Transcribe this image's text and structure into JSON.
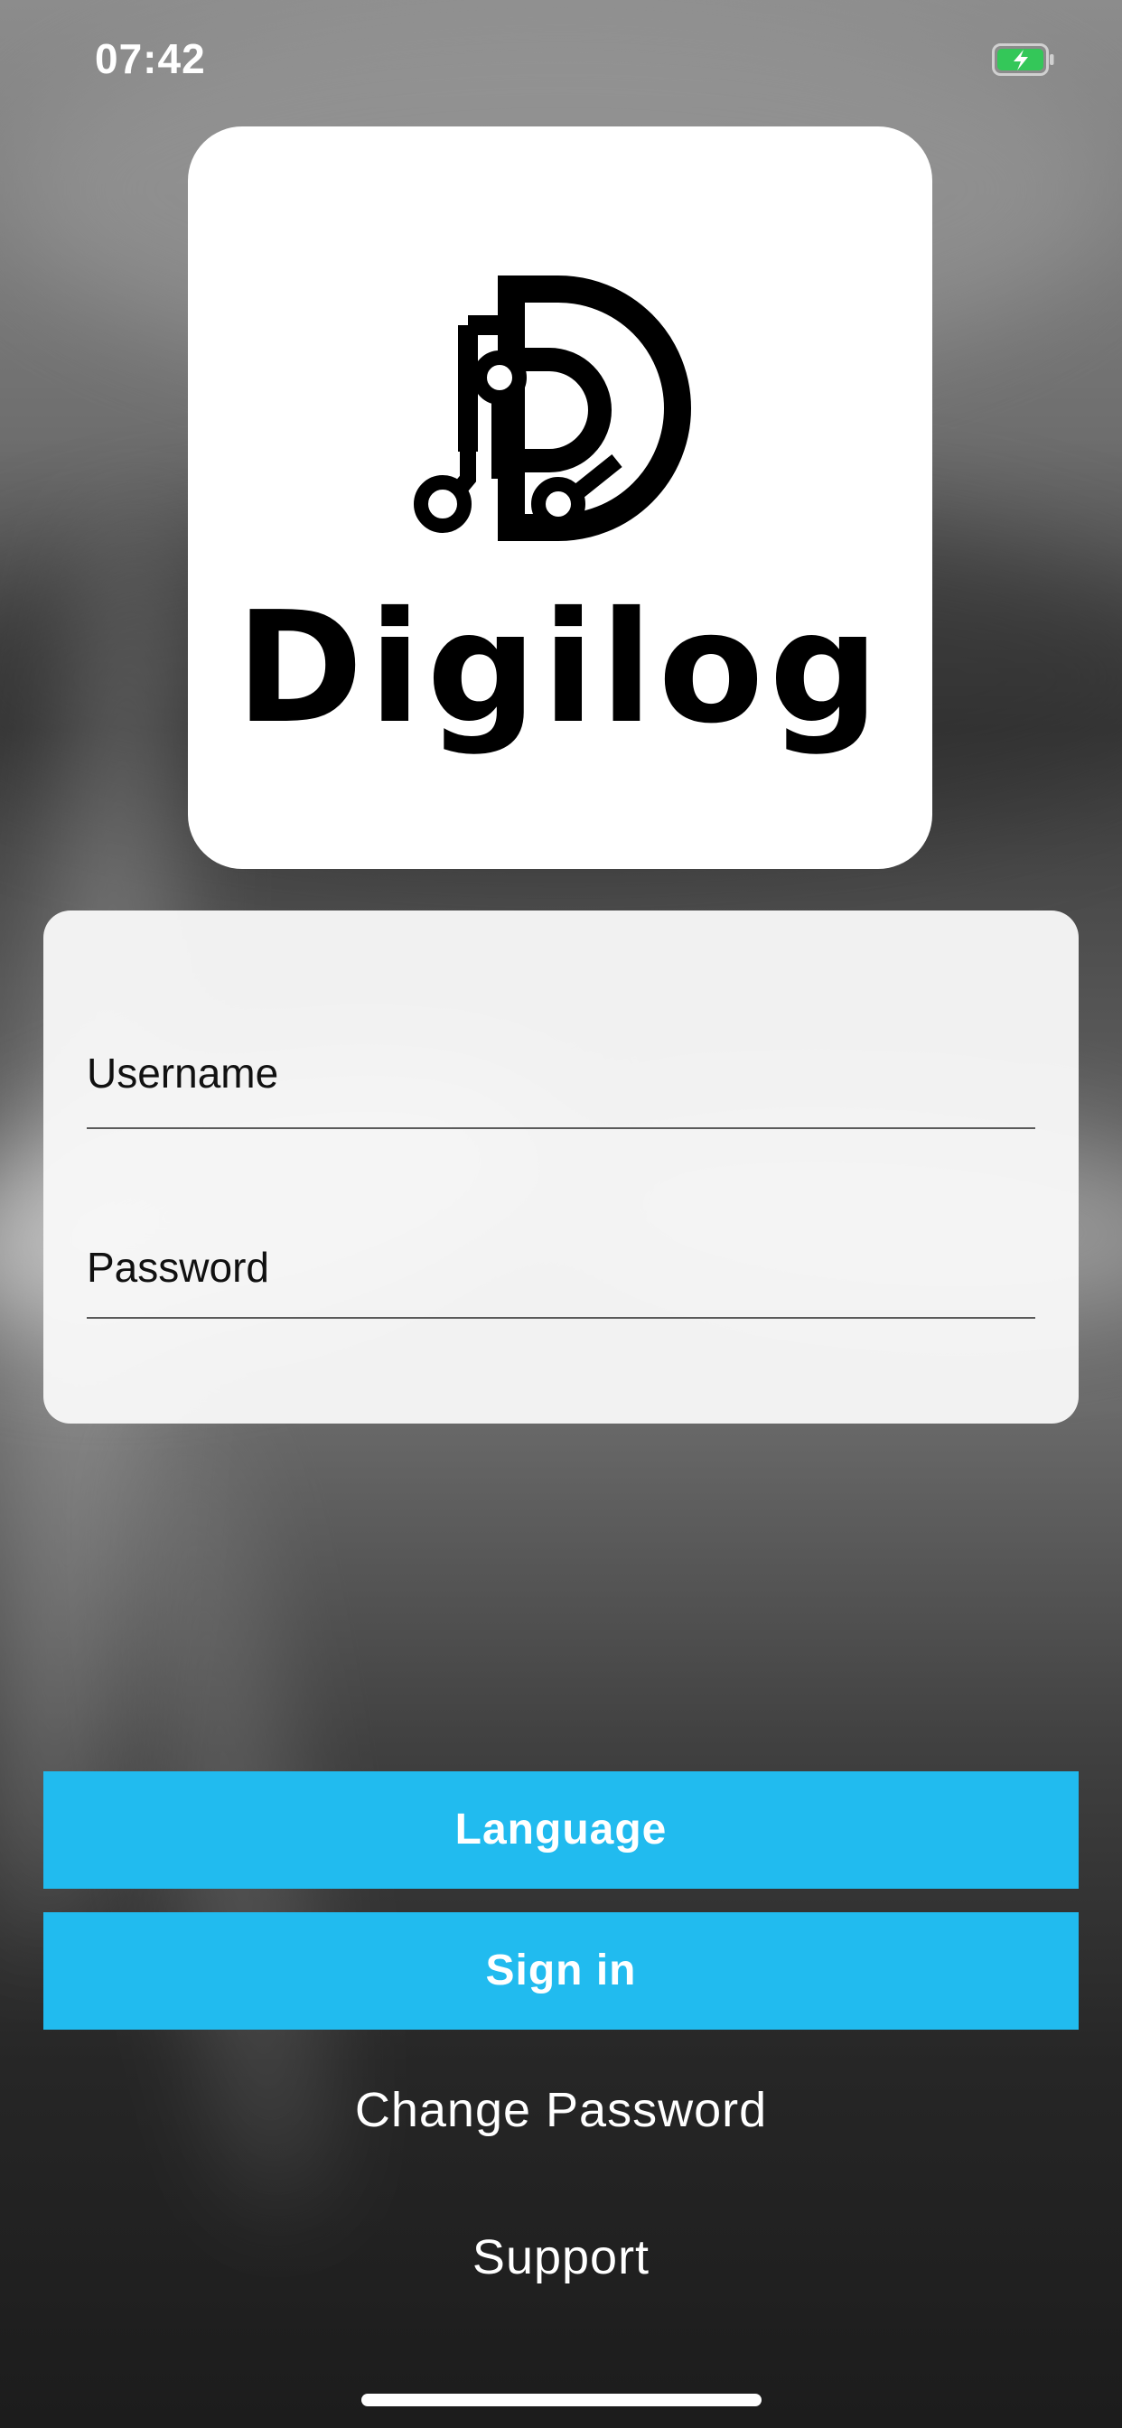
{
  "status_bar": {
    "time": "07:42",
    "battery_icon": "battery-charging-icon",
    "battery_color": "#34c759"
  },
  "logo": {
    "text": "Digilog",
    "icon": "digilog-d-circuit-logo"
  },
  "form": {
    "username_placeholder": "Username",
    "username_value": "",
    "password_placeholder": "Password",
    "password_value": ""
  },
  "actions": {
    "language_label": "Language",
    "signin_label": "Sign in",
    "change_password_label": "Change Password",
    "support_label": "Support"
  },
  "colors": {
    "accent": "#21bbef",
    "card": "#f8f8f8",
    "logo_card": "#ffffff"
  }
}
